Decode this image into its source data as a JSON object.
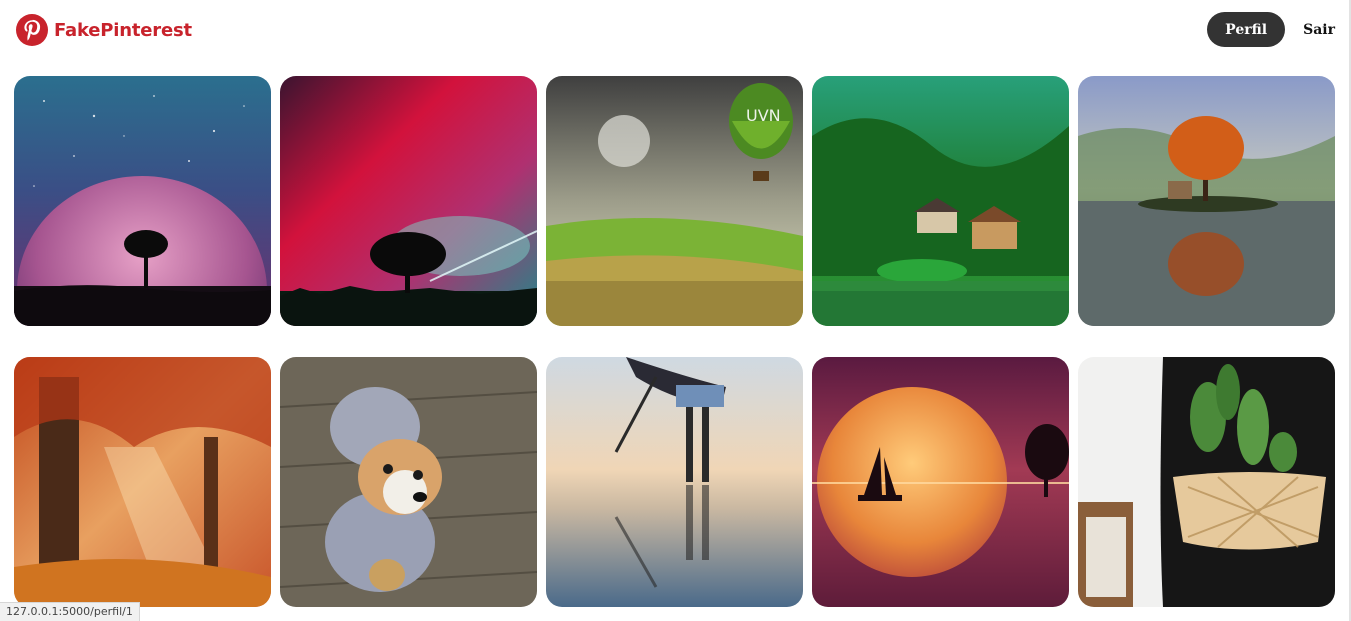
{
  "header": {
    "brand_name": "FakePinterest",
    "perfil_label": "Perfil",
    "sair_label": "Sair"
  },
  "colors": {
    "brand": "#c8232c",
    "perfil_button": "#333333"
  },
  "pins": [
    {
      "name": "pin-pink-planet-tree"
    },
    {
      "name": "pin-red-galaxy-tree"
    },
    {
      "name": "pin-surreal-balloon-landscape"
    },
    {
      "name": "pin-green-valley-houses"
    },
    {
      "name": "pin-autumn-tree-island-reflection"
    },
    {
      "name": "pin-autumn-forest-sunrays"
    },
    {
      "name": "pin-corgi-in-costume"
    },
    {
      "name": "pin-girl-sky-reflection"
    },
    {
      "name": "pin-sailboat-moon-sunset"
    },
    {
      "name": "pin-cactus-basket"
    }
  ],
  "statusbar": {
    "url": "127.0.0.1:5000/perfil/1"
  }
}
